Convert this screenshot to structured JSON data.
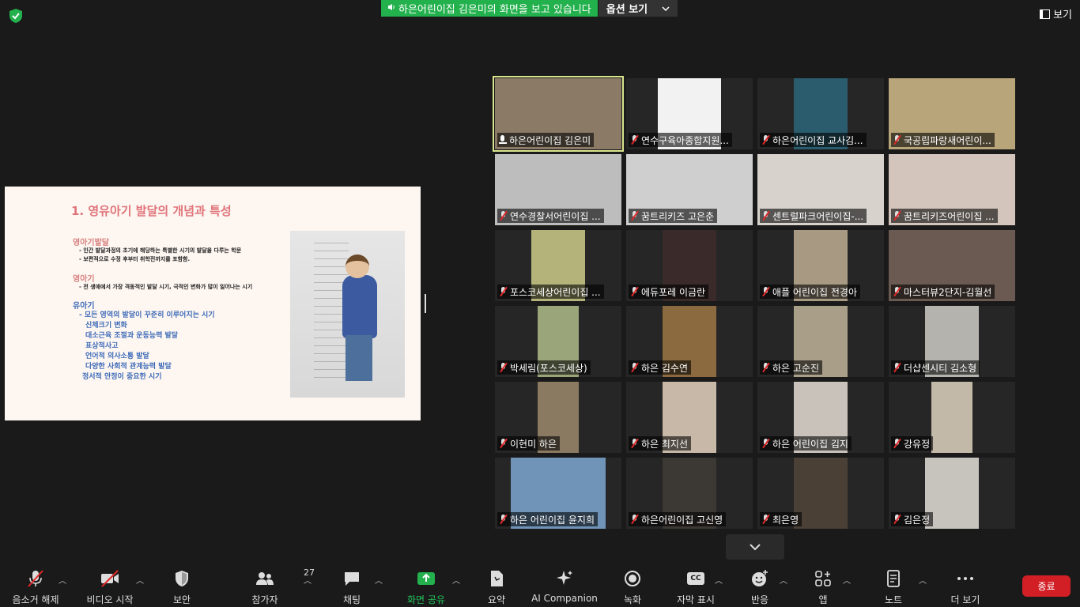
{
  "banner": {
    "share_text": "하은어린이집 김은미의 화면을 보고 있습니다",
    "options_label": "옵션 보기"
  },
  "view_label": "보기",
  "slide": {
    "title": "1. 영유아기 발달의 개념과 특성",
    "sections": [
      {
        "heading": "영아기발달",
        "lines": [
          "- 인간 발달과정의 초기에 해당하는 특별한 시기의 발달을 다루는 학문",
          "- 보편적으로 수정 후부터 취학전까지를 포함함."
        ]
      },
      {
        "heading": "영아기",
        "lines": [
          "- 전 생애에서 가장 격동적인 발달 시기, 극적인 변화가 많이 일어나는 시기"
        ]
      },
      {
        "heading": "유아기",
        "lines": [
          "- 모든 영역의 발달이 꾸준히 이루어지는 시기",
          "신체크기 변화",
          "대소근육 조절과 운동능력 발달",
          "표상적사고",
          "언어적 의사소통 발달",
          "다양한 사회적 관계능력 발달",
          "정서적 안정이 중요한 시기"
        ]
      }
    ]
  },
  "participants": [
    {
      "name": "하은어린이집 김은미",
      "muted": false,
      "active": true,
      "video": "#8a7a66",
      "vx": 0,
      "vw": 160
    },
    {
      "name": "연수구육아종합지원...",
      "muted": true,
      "video": "#f2f2f2",
      "vx": 40,
      "vw": 80
    },
    {
      "name": "하은어린이집 교사김...",
      "muted": true,
      "video": "#2a5c6e",
      "vx": 46,
      "vw": 68
    },
    {
      "name": "국공립파랑새어린이...",
      "muted": true,
      "video": "#b9a57a",
      "vx": 0,
      "vw": 160
    },
    {
      "name": "연수경찰서어린이집 ...",
      "muted": true,
      "video": "#bdbdbd",
      "vx": 0,
      "vw": 160
    },
    {
      "name": "꿈트리키즈 고은춘",
      "muted": true,
      "video": "#cfcfcf",
      "vx": 0,
      "vw": 160
    },
    {
      "name": "센트럴파크어린이집-...",
      "muted": true,
      "video": "#d7d3cc",
      "vx": 0,
      "vw": 160
    },
    {
      "name": "꿈트리키즈어린이집 ...",
      "muted": true,
      "video": "#d4c5bc",
      "vx": 0,
      "vw": 160
    },
    {
      "name": "포스코세상어린이집 ...",
      "muted": true,
      "video": "#b3b37a",
      "vx": 46,
      "vw": 68
    },
    {
      "name": "에듀포레 이금란",
      "muted": true,
      "video": "#3a2a2a",
      "vx": 46,
      "vw": 68
    },
    {
      "name": "애플 어린이집 전경아",
      "muted": true,
      "video": "#a89a82",
      "vx": 46,
      "vw": 68
    },
    {
      "name": "마스터뷰2단지-김월선",
      "muted": true,
      "video": "#6b5a52",
      "vx": 0,
      "vw": 160
    },
    {
      "name": "박세림(포스코세상)",
      "muted": true,
      "video": "#9aa67a",
      "vx": 54,
      "vw": 52
    },
    {
      "name": "하은 김수연",
      "muted": true,
      "video": "#8a6a3e",
      "vx": 46,
      "vw": 68
    },
    {
      "name": "하은 고순진",
      "muted": true,
      "video": "#a99e88",
      "vx": 46,
      "vw": 68
    },
    {
      "name": "더샵센시티 김소형",
      "muted": true,
      "video": "#b5b3ae",
      "vx": 46,
      "vw": 68
    },
    {
      "name": "이현미 하은",
      "muted": true,
      "video": "#8a7a62",
      "vx": 54,
      "vw": 52
    },
    {
      "name": "하은 최지선",
      "muted": true,
      "video": "#c8b8a8",
      "vx": 46,
      "vw": 68
    },
    {
      "name": "하은 어린이집 김지",
      "muted": true,
      "video": "#c9c2ba",
      "vx": 46,
      "vw": 68
    },
    {
      "name": "강유정",
      "muted": true,
      "video": "#c2b9a8",
      "vx": 54,
      "vw": 52
    },
    {
      "name": "하은 어린이집 윤지희",
      "muted": true,
      "video": "#6f94b8",
      "vx": 20,
      "vw": 120
    },
    {
      "name": "하은어린이집 고신영",
      "muted": true,
      "video": "#3c3834",
      "vx": 46,
      "vw": 68
    },
    {
      "name": "최은영",
      "muted": true,
      "video": "#4a4036",
      "vx": 46,
      "vw": 68
    },
    {
      "name": "김은정",
      "muted": true,
      "video": "#c7c4bd",
      "vx": 46,
      "vw": 68
    }
  ],
  "toolbar": {
    "unmute": "음소거 해제",
    "video_start": "비디오 시작",
    "security": "보안",
    "participants": "참가자",
    "participants_count": "27",
    "chat": "채팅",
    "share": "화면 공유",
    "summary": "요약",
    "ai": "AI Companion",
    "record": "녹화",
    "captions": "자막 표시",
    "cc": "CC",
    "reactions": "반응",
    "apps": "앱",
    "notes": "노트",
    "more": "더 보기",
    "end": "종료"
  },
  "colors": {
    "share_green": "#23b14d",
    "end_red": "#d21f26",
    "active_outline": "#d9e58d"
  }
}
